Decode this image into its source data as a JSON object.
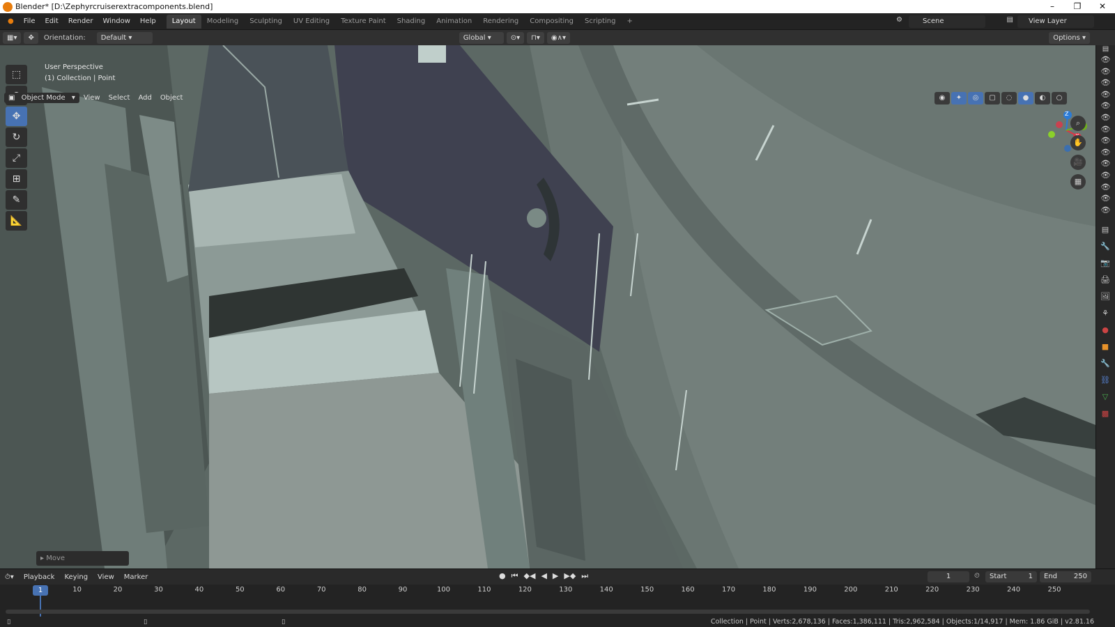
{
  "window": {
    "title": "Blender* [D:\\Zephyrcruiserextracomponents.blend]"
  },
  "menu": [
    "File",
    "Edit",
    "Render",
    "Window",
    "Help"
  ],
  "workspaces": [
    "Layout",
    "Modeling",
    "Sculpting",
    "UV Editing",
    "Texture Paint",
    "Shading",
    "Animation",
    "Rendering",
    "Compositing",
    "Scripting"
  ],
  "active_workspace": "Layout",
  "scene": {
    "name": "Scene",
    "view_layer": "View Layer"
  },
  "header": {
    "orientation_label": "Orientation:",
    "orientation_value": "Default",
    "transform_orientation": "Global",
    "options": "Options"
  },
  "viewport_header": {
    "mode": "Object Mode",
    "items": [
      "View",
      "Select",
      "Add",
      "Object"
    ]
  },
  "viewport": {
    "perspective": "User Perspective",
    "collection_info": "(1) Collection | Point",
    "last_op": "Move"
  },
  "gizmo": {
    "x": "X",
    "y": "Y",
    "z": "Z"
  },
  "timeline": {
    "menu": [
      "Playback",
      "Keying",
      "View",
      "Marker"
    ],
    "current_frame": "1",
    "start_label": "Start",
    "start": "1",
    "end_label": "End",
    "end": "250",
    "ruler": [
      "10",
      "20",
      "30",
      "40",
      "50",
      "60",
      "70",
      "80",
      "90",
      "100",
      "110",
      "120",
      "130",
      "140",
      "150",
      "160",
      "170",
      "180",
      "190",
      "200",
      "210",
      "220",
      "230",
      "240",
      "250"
    ],
    "frame_marker": "1"
  },
  "statusbar": {
    "stats": "Collection | Point | Verts:2,678,136 | Faces:1,386,111 | Tris:2,962,584 | Objects:1/14,917 | Mem: 1.86 GiB | v2.81.16"
  },
  "colors": {
    "accent": "#4772b3",
    "viewport_bg": "#5f6b66"
  }
}
